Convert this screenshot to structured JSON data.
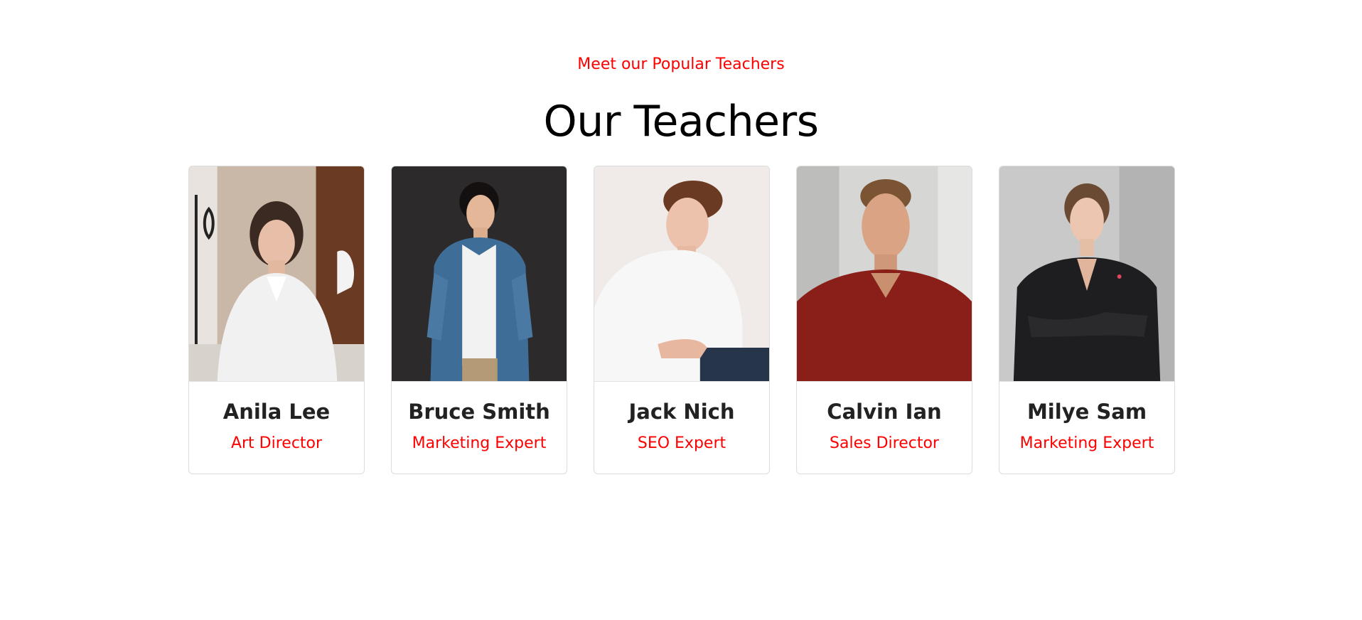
{
  "section": {
    "subtitle": "Meet our Popular Teachers",
    "title": "Our Teachers"
  },
  "colors": {
    "accent": "#ff0000",
    "heading": "#000000",
    "name": "#222222",
    "border": "#dcdcdc"
  },
  "teachers": [
    {
      "name": "Anila Lee",
      "role": "Art Director"
    },
    {
      "name": "Bruce Smith",
      "role": "Marketing Expert"
    },
    {
      "name": "Jack Nich",
      "role": "SEO Expert"
    },
    {
      "name": "Calvin Ian",
      "role": "Sales Director"
    },
    {
      "name": "Milye Sam",
      "role": "Marketing Expert"
    }
  ]
}
